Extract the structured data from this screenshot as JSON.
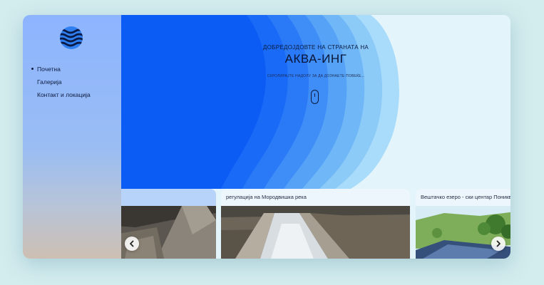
{
  "sidebar": {
    "logo_icon": "waves-logo-icon",
    "items": [
      {
        "label": "Почетна",
        "active": true
      },
      {
        "label": "Галерија",
        "active": false
      },
      {
        "label": "Контакт и локација",
        "active": false
      }
    ]
  },
  "hero": {
    "welcome": "ДОБРЕДОЈДОВТЕ НА СТРАНАТА НА",
    "title": "АКВА-ИНГ",
    "scroll_hint": "СКРОЛИРАЈТЕ НАДОЛУ ЗА ДА ДОЗНАЕТЕ ПОВЕЌЕ...",
    "scroll_icon": "mouse-scroll-icon"
  },
  "gallery": {
    "cards": [
      {
        "title": ""
      },
      {
        "title": "регулација на Мородвишка река"
      },
      {
        "title": "Вештачко езеро - ски центар Пониква"
      }
    ],
    "prev_icon": "chevron-left-icon",
    "next_icon": "chevron-right-icon"
  },
  "colors": {
    "page_bg": "#d3ecee",
    "hero_light": "#e3f5fb",
    "hero_blue": "#0a5cf5",
    "sidebar_top": "#8db4ff",
    "text_dark": "#0d1b3e"
  }
}
